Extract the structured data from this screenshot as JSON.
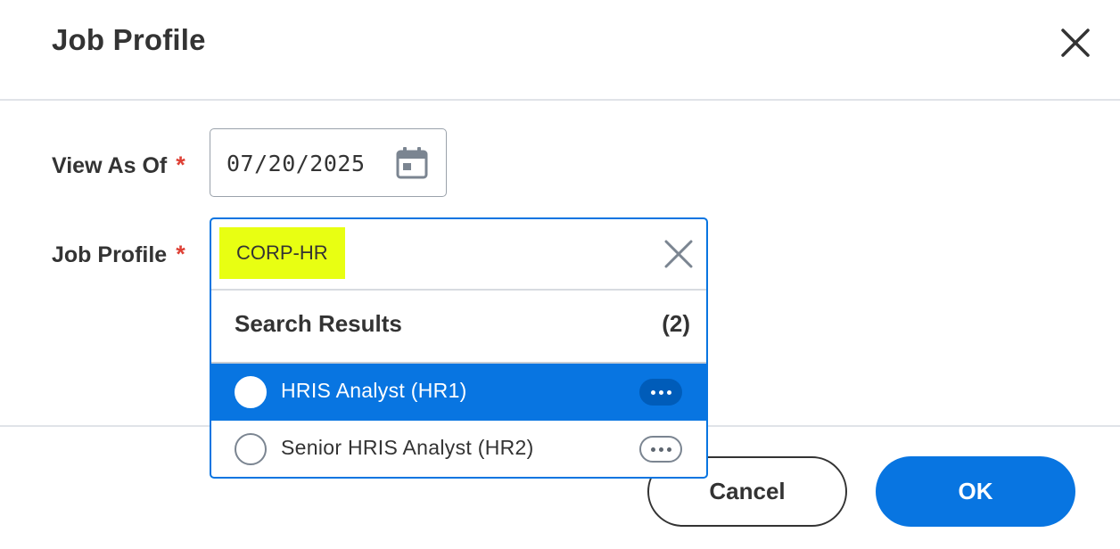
{
  "dialog": {
    "title": "Job Profile"
  },
  "form": {
    "view_as_of": {
      "label": "View As Of",
      "required_mark": "*",
      "value": "07/20/2025"
    },
    "job_profile": {
      "label": "Job Profile",
      "required_mark": "*",
      "search_term": "CORP-HR"
    }
  },
  "search_results": {
    "title": "Search Results",
    "count": "(2)",
    "items": [
      {
        "label": "HRIS Analyst (HR1)",
        "selected": true
      },
      {
        "label": "Senior HRIS Analyst (HR2)",
        "selected": false
      }
    ]
  },
  "footer": {
    "cancel_label": "Cancel",
    "ok_label": "OK"
  },
  "colors": {
    "accent": "#0875e1",
    "highlight": "#e8ff12",
    "required": "#de4035",
    "text": "#333333"
  },
  "icons": {
    "close": "close-icon",
    "calendar": "calendar-icon",
    "clear": "clear-icon",
    "more": "more-options-icon"
  }
}
